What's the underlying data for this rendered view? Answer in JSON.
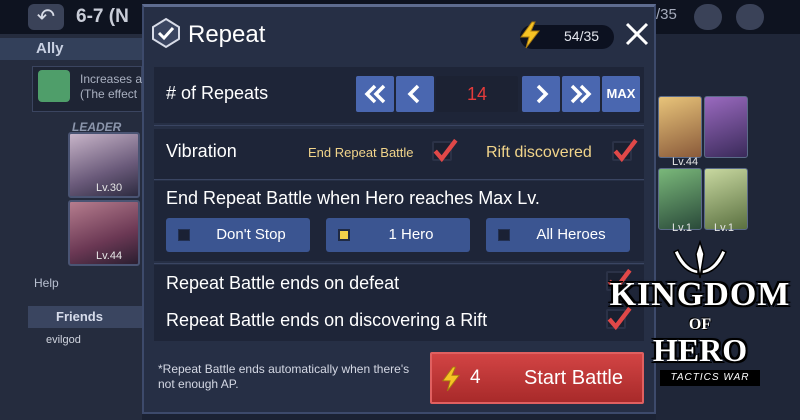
{
  "background": {
    "stage_title": "6-7 (N",
    "ap_counter": "/35",
    "ally_label": "Ally",
    "leader_bonus_text": "Increases a",
    "leader_bonus_text2": "(The effect",
    "leader_label": "LEADER",
    "card1_level": "Lv.30",
    "card2_level": "Lv.44",
    "help_label": "Help",
    "friends_label": "Friends",
    "friend_name": "evilgod",
    "right_levels": [
      "Lv.44",
      "Lv.1",
      "Lv.1"
    ]
  },
  "modal": {
    "title": "Repeat",
    "ap_display": "54/35",
    "repeats": {
      "label": "# of Repeats",
      "value": "14",
      "max_label": "MAX"
    },
    "vibration": {
      "label": "Vibration",
      "end_repeat_label": "End Repeat Battle",
      "end_repeat_checked": true,
      "rift_label": "Rift discovered",
      "rift_checked": true
    },
    "max_level": {
      "label": "End Repeat Battle when Hero reaches Max Lv.",
      "options": [
        {
          "label": "Don't Stop",
          "selected": false
        },
        {
          "label": "1 Hero",
          "selected": true
        },
        {
          "label": "All Heroes",
          "selected": false
        }
      ]
    },
    "defeat": {
      "label": "Repeat Battle ends on defeat",
      "checked": true
    },
    "rift_end": {
      "label": "Repeat Battle ends on discovering a Rift",
      "checked": true
    },
    "note": "*Repeat Battle ends automatically when there's not enough AP.",
    "start": {
      "cost": "4",
      "label": "Start Battle"
    }
  },
  "logo": {
    "line1": "KINGDOM",
    "line2": "OF",
    "line3": "HERO",
    "tagline": "TACTICS WAR"
  },
  "colors": {
    "panel": "#262f45",
    "accent_blue": "#4a67b0",
    "start_red": "#c43636",
    "count_red": "#e53b3b",
    "check_red": "#e04848"
  }
}
